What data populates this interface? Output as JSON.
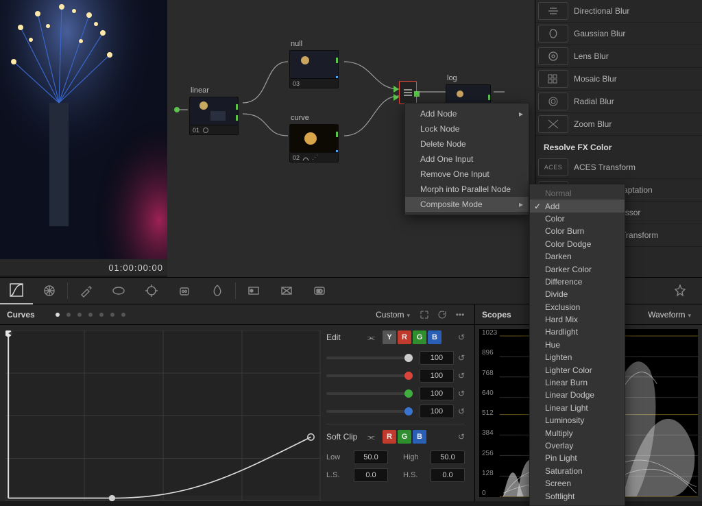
{
  "viewer": {
    "timecode": "01:00:00:00"
  },
  "nodes": {
    "n1": {
      "label": "linear",
      "num": "01"
    },
    "n2": {
      "label": "null",
      "num": "03"
    },
    "n3": {
      "label": "curve",
      "num": "02"
    },
    "n4": {
      "label": "log",
      "num": ""
    }
  },
  "fx": {
    "items": [
      "Directional Blur",
      "Gaussian Blur",
      "Lens Blur",
      "Mosaic Blur",
      "Radial Blur",
      "Zoom Blur"
    ],
    "category": "Resolve FX Color",
    "color_items": [
      "ACES Transform",
      "Chromatic Adaptation",
      "Color Compressor",
      "Color Space Transform"
    ]
  },
  "ctx_main": {
    "items": [
      "Add Node",
      "Lock Node",
      "Delete Node",
      "Add One Input",
      "Remove One Input",
      "Morph into Parallel Node",
      "Composite Mode"
    ]
  },
  "ctx_comp": {
    "items": [
      "Normal",
      "Add",
      "Color",
      "Color Burn",
      "Color Dodge",
      "Darken",
      "Darker Color",
      "Difference",
      "Divide",
      "Exclusion",
      "Hard Mix",
      "Hardlight",
      "Hue",
      "Lighten",
      "Lighter Color",
      "Linear Burn",
      "Linear Dodge",
      "Linear Light",
      "Luminosity",
      "Multiply",
      "Overlay",
      "Pin Light",
      "Saturation",
      "Screen",
      "Softlight"
    ],
    "selected_index": 1
  },
  "curves": {
    "title": "Curves",
    "mode": "Custom",
    "edit_label": "Edit",
    "values": [
      "100",
      "100",
      "100",
      "100"
    ],
    "softclip_label": "Soft Clip",
    "sc": {
      "low_label": "Low",
      "low": "50.0",
      "high_label": "High",
      "high": "50.0",
      "ls_label": "L.S.",
      "ls": "0.0",
      "hs_label": "H.S.",
      "hs": "0.0"
    }
  },
  "scopes": {
    "title": "Scopes",
    "mode": "Waveform",
    "ticks": [
      "1023",
      "896",
      "768",
      "640",
      "512",
      "384",
      "256",
      "128",
      "0"
    ]
  }
}
